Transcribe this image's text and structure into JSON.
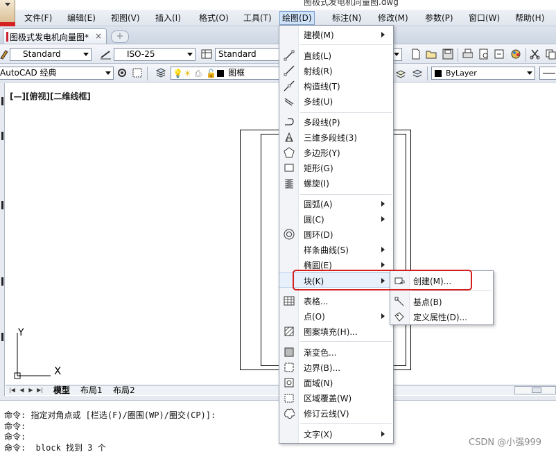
{
  "title_fragments": [
    "图极式发电机向量图.dwg"
  ],
  "menubar": {
    "items": [
      "文件(F)",
      "编辑(E)",
      "视图(V)",
      "插入(I)",
      "格式(O)",
      "工具(T)",
      "绘图(D)",
      "标注(N)",
      "修改(M)",
      "参数(P)",
      "窗口(W)",
      "帮助(H)"
    ],
    "active_index": 6
  },
  "doc_tab": {
    "label": "图极式发电机向量图*",
    "close": "×"
  },
  "toolbar1": {
    "text_style": "Standard",
    "dim_style": "ISO-25",
    "table_style": "Standard"
  },
  "toolbar2": {
    "workspace": "AutoCAD 经典",
    "layer": "图框",
    "color": "ByLayer"
  },
  "viewport_label": "[—][俯视][二维线框]",
  "ucs": {
    "x_label": "X",
    "y_label": "Y"
  },
  "layout_tabs": [
    "模型",
    "布局1",
    "布局2"
  ],
  "command_lines": [
    "命令: 指定对角点或 [栏选(F)/圈围(WP)/圈交(CP)]:",
    "命令:",
    "命令:",
    "命令:  block 找到 3 个"
  ],
  "watermark": "CSDN @小强999",
  "draw_menu": {
    "items": [
      {
        "label": "建模(M)",
        "submenu": true,
        "icon": ""
      },
      {
        "label": "直线(L)",
        "submenu": false,
        "icon": "line-icon"
      },
      {
        "label": "射线(R)",
        "submenu": false,
        "icon": "ray-icon"
      },
      {
        "label": "构造线(T)",
        "submenu": false,
        "icon": "xline-icon"
      },
      {
        "label": "多线(U)",
        "submenu": false,
        "icon": "multiline-icon"
      },
      {
        "label": "多段线(P)",
        "submenu": false,
        "icon": "polyline-icon"
      },
      {
        "label": "三维多段线(3)",
        "submenu": false,
        "icon": "3dpoly-icon"
      },
      {
        "label": "多边形(Y)",
        "submenu": false,
        "icon": "polygon-icon"
      },
      {
        "label": "矩形(G)",
        "submenu": false,
        "icon": "rectangle-icon"
      },
      {
        "label": "螺旋(I)",
        "submenu": false,
        "icon": "helix-icon"
      },
      {
        "label": "圆弧(A)",
        "submenu": true,
        "icon": ""
      },
      {
        "label": "圆(C)",
        "submenu": true,
        "icon": ""
      },
      {
        "label": "圆环(D)",
        "submenu": false,
        "icon": "donut-icon"
      },
      {
        "label": "样条曲线(S)",
        "submenu": true,
        "icon": ""
      },
      {
        "label": "椭圆(E)",
        "submenu": true,
        "icon": ""
      },
      {
        "label": "块(K)",
        "submenu": true,
        "icon": ""
      },
      {
        "label": "表格...",
        "submenu": false,
        "icon": "table-icon"
      },
      {
        "label": "点(O)",
        "submenu": true,
        "icon": ""
      },
      {
        "label": "图案填充(H)...",
        "submenu": false,
        "icon": "hatch-icon"
      },
      {
        "label": "渐变色...",
        "submenu": false,
        "icon": "gradient-icon"
      },
      {
        "label": "边界(B)...",
        "submenu": false,
        "icon": "boundary-icon"
      },
      {
        "label": "面域(N)",
        "submenu": false,
        "icon": "region-icon"
      },
      {
        "label": "区域覆盖(W)",
        "submenu": false,
        "icon": "wipeout-icon"
      },
      {
        "label": "修订云线(V)",
        "submenu": false,
        "icon": "revcloud-icon"
      },
      {
        "label": "文字(X)",
        "submenu": true,
        "icon": ""
      }
    ]
  },
  "block_submenu": {
    "items": [
      {
        "label": "创建(M)...",
        "icon": "block-create-icon"
      },
      {
        "label": "基点(B)",
        "icon": "basepoint-icon"
      },
      {
        "label": "定义属性(D)...",
        "icon": "attribute-define-icon"
      }
    ]
  },
  "colors": {
    "accent_red": "#d31e1e",
    "menu_highlight": "#e8f1fb"
  }
}
